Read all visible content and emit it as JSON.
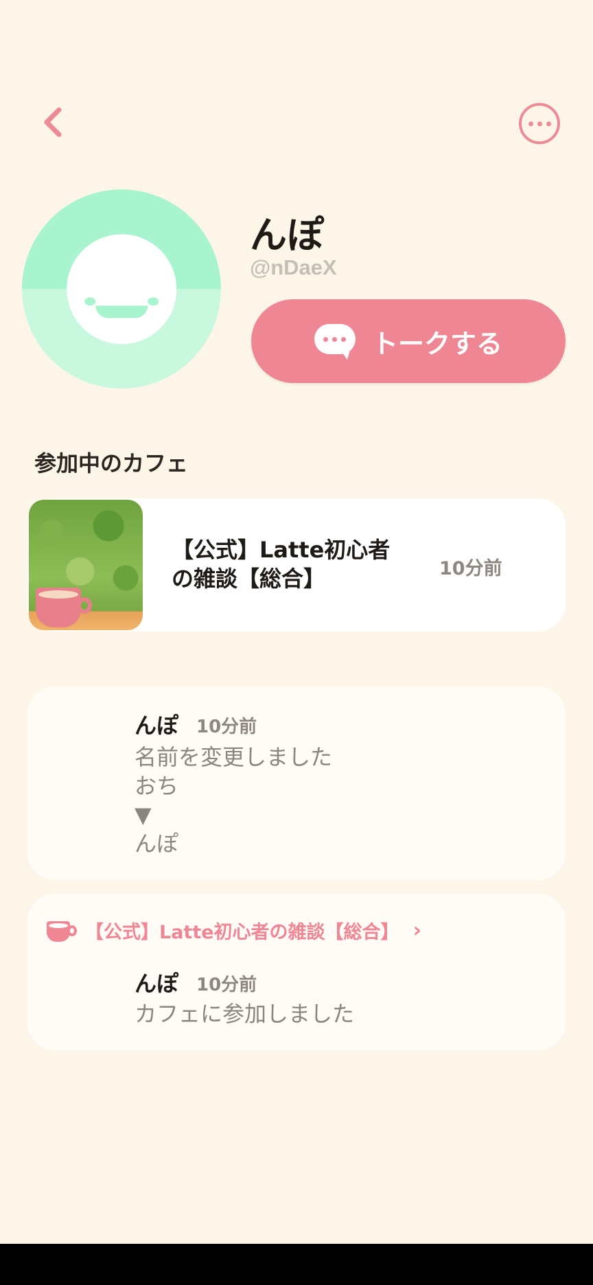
{
  "colors": {
    "background": "#fdf6e8",
    "accent_pink": "#ef8693",
    "avatar_green": "#a8f4cf",
    "avatar_green_light": "#c8f9de"
  },
  "header": {
    "back_icon": "chevron-left-icon",
    "more_icon": "ellipsis-circle-icon"
  },
  "profile": {
    "name": "んぽ",
    "handle": "@nDaeX",
    "talk_button_label": "トークする",
    "talk_button_icon": "chat-bubble-icon"
  },
  "cafes_section": {
    "title": "参加中のカフェ",
    "cafes": [
      {
        "title_line1": "【公式】Latte初心者",
        "title_line2": "の雑談【総合】",
        "time": "10分前"
      }
    ]
  },
  "activity": [
    {
      "name": "んぽ",
      "time": "10分前",
      "message_lines": [
        "名前を変更しました",
        "おち",
        "▼",
        "んぽ"
      ]
    },
    {
      "cafe_label": "【公式】Latte初心者の雑談【総合】",
      "name": "んぽ",
      "time": "10分前",
      "message": "カフェに参加しました"
    }
  ]
}
